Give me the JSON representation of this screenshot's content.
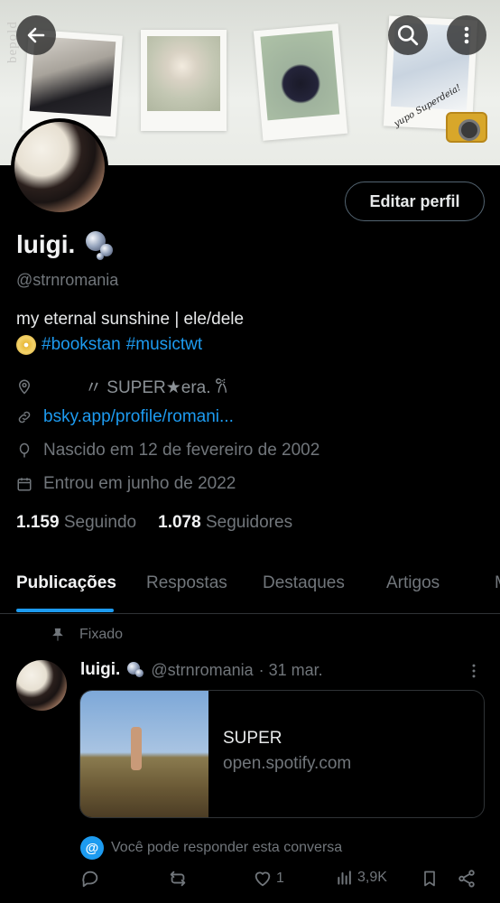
{
  "banner": {
    "watermark": "bepold",
    "doodle_text": "yupo Superdeia!"
  },
  "header": {
    "back_icon": "arrow-left-icon",
    "search_icon": "search-icon",
    "more_icon": "more-vertical-icon"
  },
  "profile": {
    "edit_button_label": "Editar perfil",
    "display_name": "luigi.",
    "handle": "@strnromania",
    "bio_line1": "my eternal sunshine | ele/dele",
    "hashtag1": "#bookstan",
    "hashtag2": "#musictwt",
    "location": "〃 SUPER★era. 𐙚",
    "link": "bsky.app/profile/romani...",
    "birthdate": "Nascido em 12 de fevereiro de 2002",
    "joined": "Entrou em junho de 2022",
    "following_count": "1.159",
    "following_label": "Seguindo",
    "followers_count": "1.078",
    "followers_label": "Seguidores"
  },
  "tabs": [
    {
      "label": "Publicações",
      "active": true
    },
    {
      "label": "Respostas",
      "active": false
    },
    {
      "label": "Destaques",
      "active": false
    },
    {
      "label": "Artigos",
      "active": false
    },
    {
      "label": "M",
      "active": false
    }
  ],
  "post": {
    "pinned_label": "Fixado",
    "author_name": "luigi.",
    "author_handle": "@strnromania",
    "date": "· 31 mar.",
    "card_title": "SUPER",
    "card_domain": "open.spotify.com",
    "reply_notice": "Você pode responder esta conversa",
    "likes": "1",
    "views": "3,9K"
  },
  "colors": {
    "accent": "#1d9bf0",
    "background": "#000000",
    "muted": "#71767b",
    "border": "#2f3336"
  }
}
